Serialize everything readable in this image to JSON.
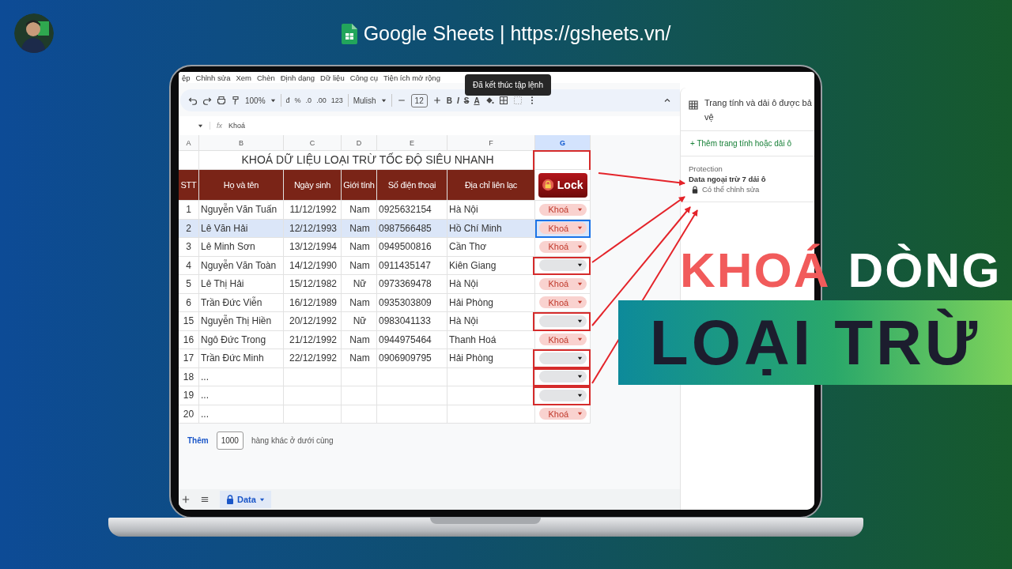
{
  "header": {
    "title": "Google Sheets | https://gsheets.vn/"
  },
  "menu": [
    "ệp",
    "Chỉnh sửa",
    "Xem",
    "Chèn",
    "Định dạng",
    "Dữ liệu",
    "Công cụ",
    "Tiện ích mở rộng"
  ],
  "tooltip": "Đã kết thúc tập lệnh",
  "toolbar": {
    "zoom": "100%",
    "formats": [
      "đ",
      "%",
      ".0",
      ".00",
      "123"
    ],
    "font": "Mulish",
    "font_size": "12",
    "styles": [
      "B",
      "I",
      "S",
      "A"
    ]
  },
  "formula_bar": {
    "fx": "fx",
    "value": "Khoá"
  },
  "columns": [
    {
      "label": "A",
      "selected": false
    },
    {
      "label": "B",
      "selected": false
    },
    {
      "label": "C",
      "selected": false
    },
    {
      "label": "D",
      "selected": false
    },
    {
      "label": "E",
      "selected": false
    },
    {
      "label": "F",
      "selected": false
    },
    {
      "label": "G",
      "selected": true
    }
  ],
  "sheet_title": "KHOÁ DỮ LIỆU LOẠI TRỪ TỐC ĐỘ SIÊU NHANH",
  "table_headers": [
    "STT",
    "Họ và tên",
    "Ngày sinh",
    "Giới tính",
    "Số điện thoại",
    "Địa chỉ liên lạc"
  ],
  "lock_button": "Lock",
  "rows": [
    {
      "cells": [
        "1",
        "Nguyễn Văn Tuấn",
        "11/12/1992",
        "Nam",
        "0925632154",
        "Hà Nội"
      ],
      "chip": {
        "label": "Khoá"
      },
      "selected": false,
      "outlined": false
    },
    {
      "cells": [
        "2",
        "Lê Văn Hải",
        "12/12/1993",
        "Nam",
        "0987566485",
        "Hồ Chí Minh"
      ],
      "chip": {
        "label": "Khoá"
      },
      "selected": true,
      "outlined": false
    },
    {
      "cells": [
        "3",
        "Lê Minh Sơn",
        "13/12/1994",
        "Nam",
        "0949500816",
        "Cần Thơ"
      ],
      "chip": {
        "label": "Khoá"
      },
      "selected": false,
      "outlined": false
    },
    {
      "cells": [
        "4",
        "Nguyễn Văn Toàn",
        "14/12/1990",
        "Nam",
        "0911435147",
        "Kiên Giang"
      ],
      "chip": {},
      "selected": false,
      "outlined": true
    },
    {
      "cells": [
        "5",
        "Lê Thị Hải",
        "15/12/1982",
        "Nữ",
        "0973369478",
        "Hà Nội"
      ],
      "chip": {
        "label": "Khoá"
      },
      "selected": false,
      "outlined": false
    },
    {
      "cells": [
        "6",
        "Trần Đức Viễn",
        "16/12/1989",
        "Nam",
        "0935303809",
        "Hải Phòng"
      ],
      "chip": {
        "label": "Khoá"
      },
      "selected": false,
      "outlined": false
    },
    {
      "cells": [
        "15",
        "Nguyễn Thị Hiền",
        "20/12/1992",
        "Nữ",
        "0983041133",
        "Hà Nội"
      ],
      "chip": {},
      "selected": false,
      "outlined": true
    },
    {
      "cells": [
        "16",
        "Ngô Đức Trong",
        "21/12/1992",
        "Nam",
        "0944975464",
        "Thanh Hoá"
      ],
      "chip": {
        "label": "Khoá"
      },
      "selected": false,
      "outlined": false
    },
    {
      "cells": [
        "17",
        "Trần Đức Minh",
        "22/12/1992",
        "Nam",
        "0906909795",
        "Hải Phòng"
      ],
      "chip": {},
      "selected": false,
      "outlined": true
    },
    {
      "cells": [
        "18",
        "..."
      ],
      "chip": {},
      "selected": false,
      "outlined": true
    },
    {
      "cells": [
        "19",
        "..."
      ],
      "chip": {},
      "selected": false,
      "outlined": true
    },
    {
      "cells": [
        "20",
        "..."
      ],
      "chip": {
        "label": "Khoá"
      },
      "selected": false,
      "outlined": false
    }
  ],
  "add_rows": {
    "button": "Thêm",
    "value": "1000",
    "suffix": "hàng khác ở dưới cùng"
  },
  "sheet_tabs": [
    {
      "label": "Data",
      "selected": true,
      "locked": true
    }
  ],
  "side_panel": {
    "title": "Trang tính và dải ô được bả vệ",
    "add_link": "+ Thêm trang tính hoặc dải ô",
    "section": "Protection",
    "range": "Data ngoại trừ 7 dải ô",
    "permission": "Có thể chỉnh sửa"
  },
  "overlay": {
    "line_1": [
      {
        "text": "KHOÁ",
        "color": "#f15b5b"
      },
      {
        "text": "DÒNG",
        "color": "#ffffff"
      }
    ],
    "banner": "LOẠI TRỪ"
  }
}
